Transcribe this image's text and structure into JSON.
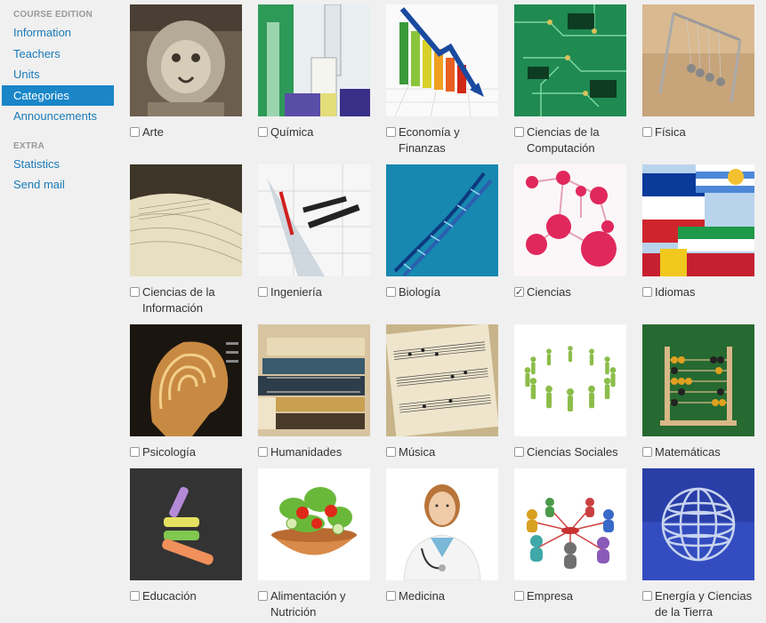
{
  "sidebar": {
    "section1_title": "COURSE EDITION",
    "section1_items": [
      "Information",
      "Teachers",
      "Units",
      "Categories",
      "Announcements"
    ],
    "active_item": "Categories",
    "section2_title": "EXTRA",
    "section2_items": [
      "Statistics",
      "Send mail"
    ]
  },
  "categories": [
    {
      "label": "Arte",
      "checked": false,
      "image": "lion-statue"
    },
    {
      "label": "Química",
      "checked": false,
      "image": "test-tubes"
    },
    {
      "label": "Economía y Finanzas",
      "checked": false,
      "image": "bar-chart-arrow"
    },
    {
      "label": "Ciencias de la Computación",
      "checked": false,
      "image": "circuit-board"
    },
    {
      "label": "Física",
      "checked": false,
      "image": "newtons-cradle"
    },
    {
      "label": "Ciencias de la Información",
      "checked": false,
      "image": "open-book"
    },
    {
      "label": "Ingeniería",
      "checked": false,
      "image": "drafting-tools"
    },
    {
      "label": "Biología",
      "checked": false,
      "image": "dna-helix"
    },
    {
      "label": "Ciencias",
      "checked": true,
      "image": "molecules"
    },
    {
      "label": "Idiomas",
      "checked": false,
      "image": "flags"
    },
    {
      "label": "Psicología",
      "checked": false,
      "image": "brain-scan"
    },
    {
      "label": "Humanidades",
      "checked": false,
      "image": "book-stack"
    },
    {
      "label": "Música",
      "checked": false,
      "image": "sheet-music"
    },
    {
      "label": "Ciencias Sociales",
      "checked": false,
      "image": "people-circle"
    },
    {
      "label": "Matemáticas",
      "checked": false,
      "image": "abacus"
    },
    {
      "label": "Educación",
      "checked": false,
      "image": "chalk"
    },
    {
      "label": "Alimentación y Nutrición",
      "checked": false,
      "image": "salad-bowl"
    },
    {
      "label": "Medicina",
      "checked": false,
      "image": "doctor"
    },
    {
      "label": "Empresa",
      "checked": false,
      "image": "business-people"
    },
    {
      "label": "Energía y Ciencias de la Tierra",
      "checked": false,
      "image": "wire-globe"
    }
  ],
  "colors": {
    "link": "#1a7ab8",
    "active_bg": "#1a86c8",
    "background": "#f0f0f0"
  }
}
